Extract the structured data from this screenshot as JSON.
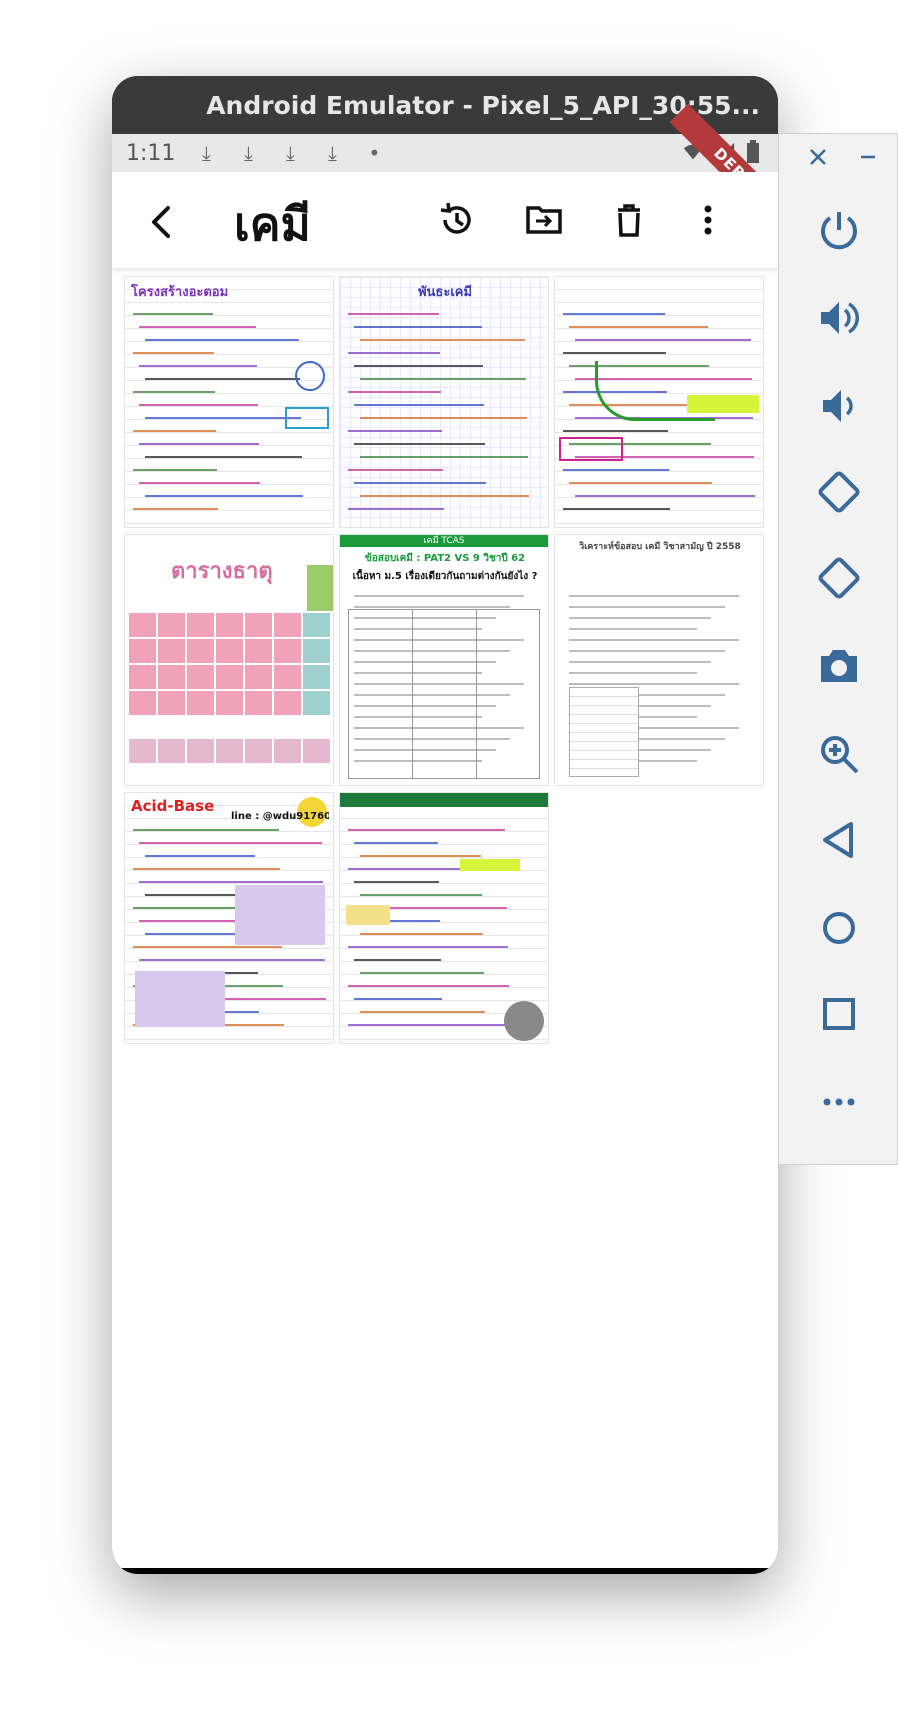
{
  "window": {
    "title": "Android Emulator - Pixel_5_API_30:55..."
  },
  "statusbar": {
    "time": "1:11",
    "debug_label": "DEBUG"
  },
  "appbar": {
    "title": "เคมี",
    "icons": [
      "back-icon",
      "history-icon",
      "move-to-folder-icon",
      "delete-icon",
      "more-vert-icon"
    ]
  },
  "thumbnails": [
    {
      "title": "โครงสร้างอะตอม",
      "style": "notes",
      "accent": "#7b2fbf"
    },
    {
      "title": "พันธะเคมี",
      "style": "grid-notes",
      "accent": "#3a3ab8"
    },
    {
      "title": "",
      "style": "notes-plain",
      "accent": "#222222"
    },
    {
      "title": "ตารางธาตุ",
      "style": "periodic",
      "accent": "#d66fa0"
    },
    {
      "title": "ข้อสอบเคมี : PAT2 VS 9 วิชาปี 62",
      "subtitle": "เนื้อหา ม.5 เรื่องเดียวกันถามต่างกันยังไง ?",
      "badge": "เคมี TCAS",
      "style": "doc-table",
      "accent": "#1a9a3a"
    },
    {
      "title": "วิเคราะห์ข้อสอบ เคมี วิชาสามัญ ปี 2558",
      "style": "doc",
      "accent": "#444444"
    },
    {
      "title": "Acid-Base",
      "subtitle": "line : @wdu91760",
      "style": "acid",
      "accent": "#e02020"
    },
    {
      "title": "",
      "style": "notes-yellow",
      "accent": "#1e7a3a"
    }
  ],
  "side_toolbar": {
    "icons": [
      "close-icon",
      "minimize-icon",
      "power-icon",
      "volume-up-icon",
      "volume-down-icon",
      "rotate-left-icon",
      "rotate-right-icon",
      "camera-icon",
      "zoom-icon",
      "back-icon",
      "home-icon",
      "overview-icon",
      "more-icon"
    ]
  },
  "colors": {
    "appbar_bg": "#ffffff",
    "status_bg": "#e8e8e8",
    "nav_bg": "#000000",
    "debug": "#b23a3a",
    "emulator_frame": "#2b2b2b"
  }
}
